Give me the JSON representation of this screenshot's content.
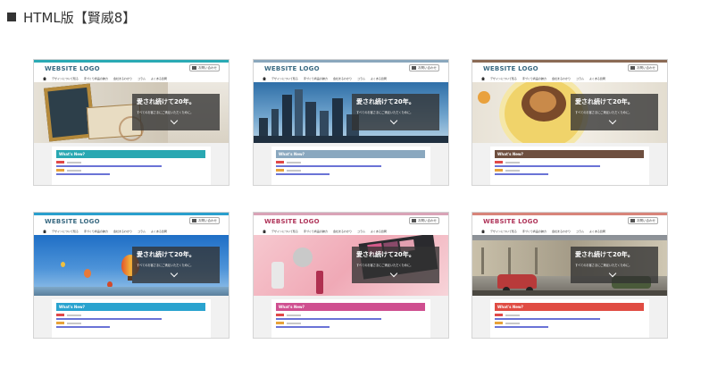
{
  "heading": {
    "label": "HTML版【賢威8】"
  },
  "template": {
    "logo_word1": "WEBSITE",
    "logo_word2": "LOGO",
    "contact_label": "お問い合わせ",
    "nav": [
      "デザインについて知る",
      "手づくり商品の魅力",
      "会社まるわかり",
      "コラム",
      "よくある質問"
    ],
    "hero_title": "愛され続けて20年。",
    "hero_sub": "すべてのお客さまにご満足いただくために。",
    "news_heading": "What's New?"
  },
  "thumbnails": [
    {
      "name": "template-books",
      "accent": "#2aaab4",
      "news_color": "#29a8b2",
      "hero": "books"
    },
    {
      "name": "template-city",
      "accent": "#8aa7bd",
      "news_color": "#8aa8bf",
      "hero": "city"
    },
    {
      "name": "template-food",
      "accent": "#8b6a55",
      "news_color": "#6e4f3f",
      "hero": "food"
    },
    {
      "name": "template-balloons",
      "accent": "#2a9fcd",
      "news_color": "#29a3cf",
      "hero": "balloons"
    },
    {
      "name": "template-cosmetics",
      "accent": "#d9a3b7",
      "news_color": "#cf4f90",
      "hero": "cosmetics"
    },
    {
      "name": "template-street",
      "accent": "#d8847a",
      "news_color": "#e04c43",
      "hero": "street"
    }
  ],
  "colors": {
    "tag_red": "#e04848",
    "tag_orange": "#e8a33a",
    "link_blue": "#6a73d6"
  }
}
